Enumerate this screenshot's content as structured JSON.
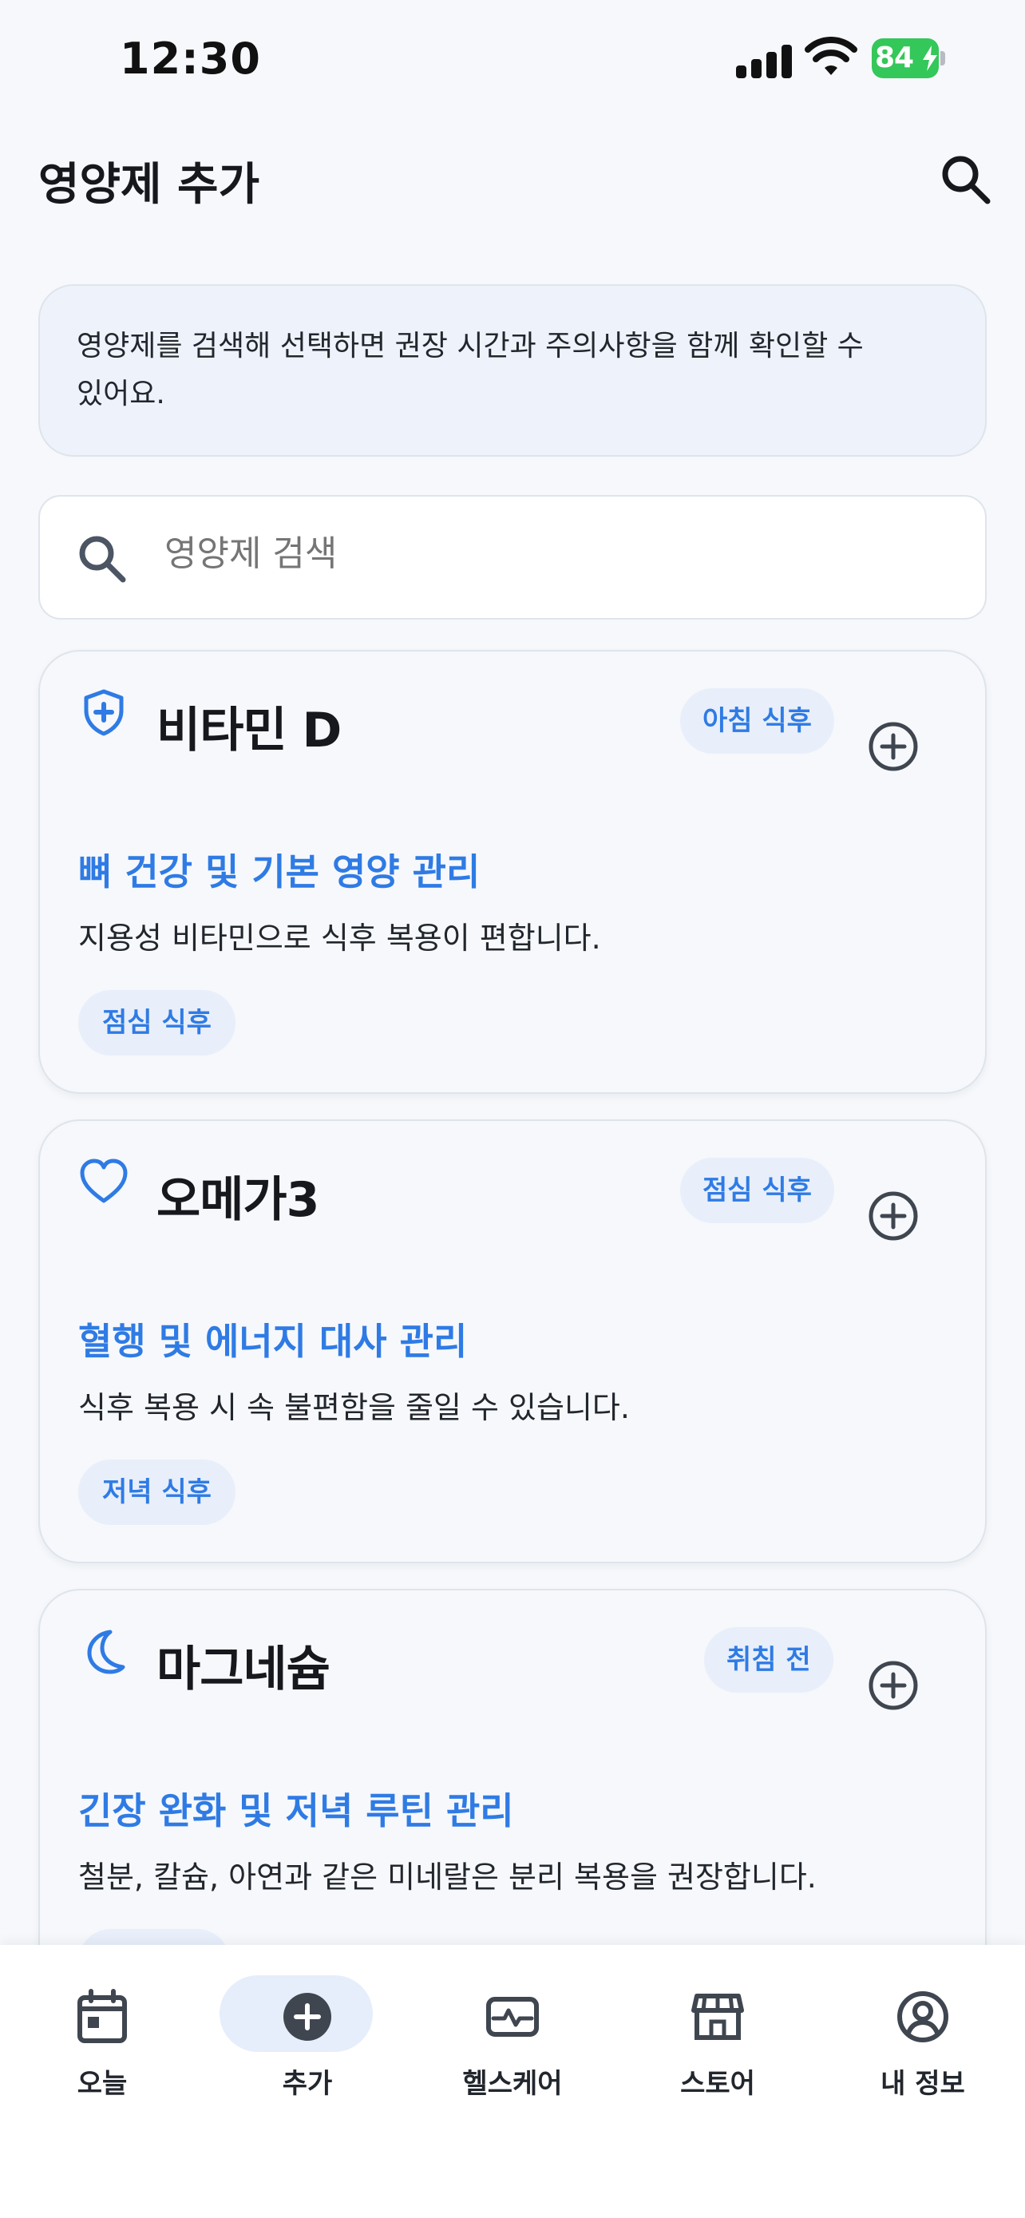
{
  "status_bar": {
    "time": "12:30",
    "battery": "84",
    "icons": [
      "signal-icon",
      "wifi-icon",
      "battery-icon"
    ]
  },
  "header": {
    "title": "영양제 추가",
    "search_icon": "search-icon"
  },
  "info_banner": {
    "text_line1": "영양제를 검색해 선택하면 권장 시간과 주의사항을 함께 확인할 수",
    "text_line2": "있어요."
  },
  "search": {
    "placeholder": "영양제 검색",
    "value": ""
  },
  "supplements": [
    {
      "name": "비타민 D",
      "icon": "shield-plus-icon",
      "time_badge": "아침 식후",
      "purpose": "뼈 건강 및 기본 영양 관리",
      "note": "지용성 비타민으로 식후 복용이 편합니다.",
      "alt_time": "점심 식후"
    },
    {
      "name": "오메가3",
      "icon": "heart-icon",
      "time_badge": "점심 식후",
      "purpose": "혈행 및 에너지 대사 관리",
      "note": "식후 복용 시 속 불편함을 줄일 수 있습니다.",
      "alt_time": "저녁 식후"
    },
    {
      "name": "마그네슘",
      "icon": "moon-icon",
      "time_badge": "취침 전",
      "purpose": "긴장 완화 및 저녁 루틴 관리",
      "note": "철분, 칼슘, 아연과 같은 미네랄은 분리 복용을 권장합니다.",
      "alt_time": ""
    }
  ],
  "tab_bar": {
    "tabs": [
      {
        "label": "오늘",
        "icon": "calendar-icon",
        "active": false
      },
      {
        "label": "추가",
        "icon": "plus-circle-icon",
        "active": true
      },
      {
        "label": "헬스케어",
        "icon": "health-monitor-icon",
        "active": false
      },
      {
        "label": "스토어",
        "icon": "store-icon",
        "active": false
      },
      {
        "label": "내 정보",
        "icon": "profile-icon",
        "active": false
      }
    ]
  },
  "colors": {
    "accent": "#2f7be5",
    "pill_bg": "#e8effa",
    "background": "#f6f8fb",
    "battery": "#34c759",
    "text": "#16181d"
  }
}
